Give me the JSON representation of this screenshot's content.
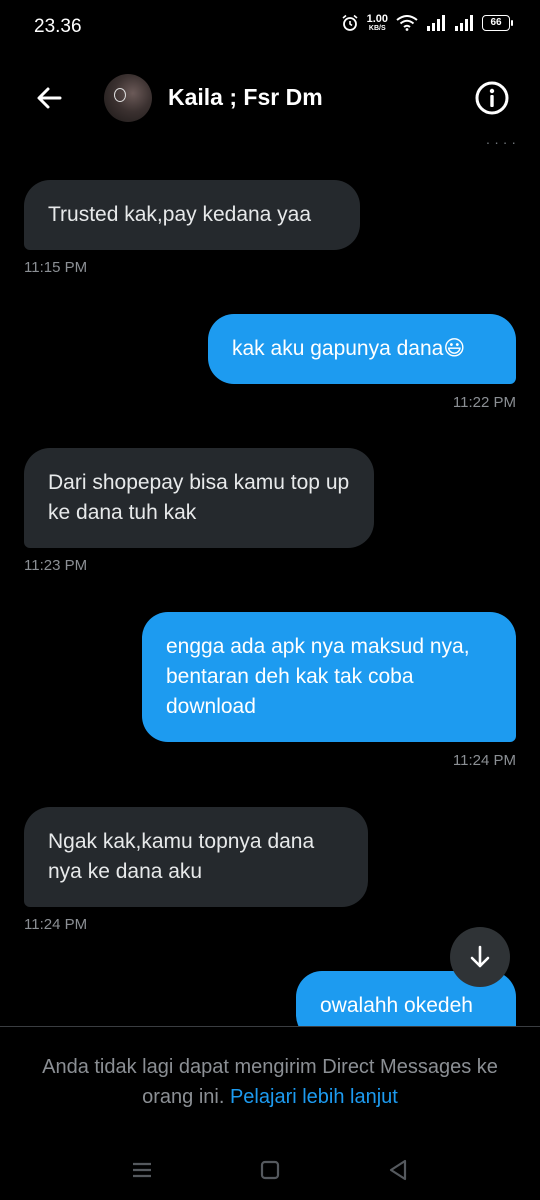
{
  "status_bar": {
    "time": "23.36",
    "net_speed_value": "1.00",
    "net_speed_unit": "KB/S",
    "battery": "66"
  },
  "header": {
    "title": "Kaila ; Fsr Dm",
    "back_icon": "arrow-left-icon",
    "info_icon": "info-icon"
  },
  "messages": [
    {
      "direction": "in",
      "text": "Trusted kak,pay kedana yaa",
      "time": "11:15 PM"
    },
    {
      "direction": "out",
      "text": "kak aku gapunya dana😃",
      "time": "11:22 PM"
    },
    {
      "direction": "in",
      "text": "Dari shopepay bisa kamu top up ke dana tuh kak",
      "time": "11:23 PM"
    },
    {
      "direction": "out",
      "text": "engga ada apk nya maksud nya, bentaran deh kak tak coba download",
      "time": "11:24 PM"
    },
    {
      "direction": "in",
      "text": "Ngak kak,kamu topnya dana nya ke dana aku",
      "time": "11:24 PM"
    },
    {
      "direction": "out",
      "text": "owalahh okedeh",
      "time": ""
    }
  ],
  "footer": {
    "notice_text": "Anda tidak lagi dapat mengirim Direct Messages ke orang ini.",
    "notice_link": "Pelajari lebih lanjut"
  },
  "colors": {
    "accent": "#1d9bf0",
    "incoming_bubble": "#25292d",
    "background": "#000000",
    "muted_text": "#8b8f94"
  }
}
